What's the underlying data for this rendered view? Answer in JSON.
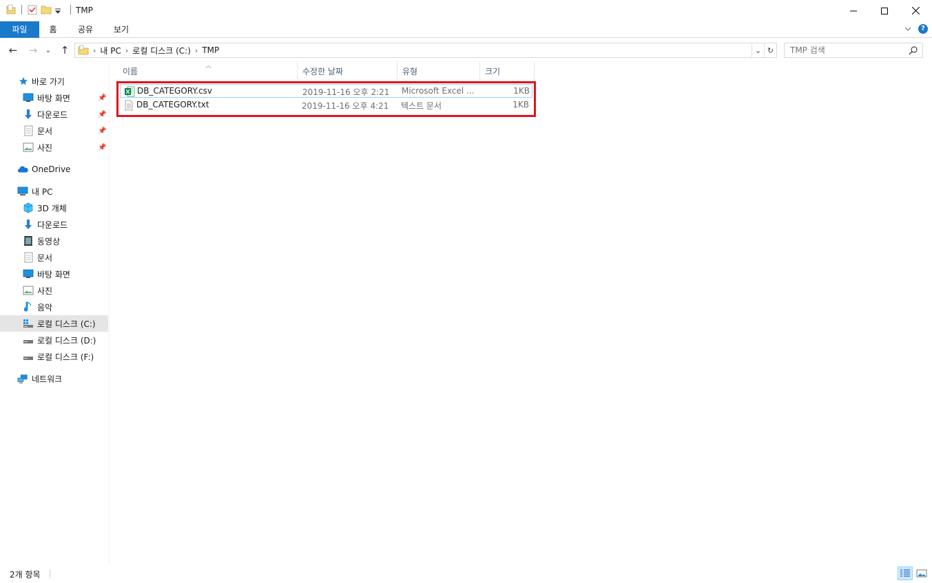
{
  "window": {
    "title": "TMP",
    "controls": {
      "minimize": "—",
      "maximize": "☐",
      "close": "✕"
    }
  },
  "ribbon": {
    "tabs": [
      "파일",
      "홈",
      "공유",
      "보기"
    ]
  },
  "navigation": {
    "back": "←",
    "forward": "→",
    "recent": "⌄",
    "up": "↑",
    "breadcrumb": [
      "내 PC",
      "로컬 디스크 (C:)",
      "TMP"
    ],
    "search_placeholder": "TMP 검색"
  },
  "sidebar": {
    "quick_access": {
      "label": "바로 가기",
      "items": [
        {
          "label": "바탕 화면",
          "icon": "desktop-icon",
          "pinned": true
        },
        {
          "label": "다운로드",
          "icon": "download-icon",
          "pinned": true
        },
        {
          "label": "문서",
          "icon": "document-icon",
          "pinned": true
        },
        {
          "label": "사진",
          "icon": "pictures-icon",
          "pinned": true
        }
      ]
    },
    "onedrive": {
      "label": "OneDrive"
    },
    "this_pc": {
      "label": "내 PC",
      "items": [
        {
          "label": "3D 개체",
          "icon": "3d-objects-icon"
        },
        {
          "label": "다운로드",
          "icon": "download-icon"
        },
        {
          "label": "동영상",
          "icon": "video-icon"
        },
        {
          "label": "문서",
          "icon": "document-icon"
        },
        {
          "label": "바탕 화면",
          "icon": "desktop-icon"
        },
        {
          "label": "사진",
          "icon": "pictures-icon"
        },
        {
          "label": "음악",
          "icon": "music-icon"
        },
        {
          "label": "로컬 디스크 (C:)",
          "icon": "windows-drive-icon",
          "selected": true
        },
        {
          "label": "로컬 디스크 (D:)",
          "icon": "drive-icon"
        },
        {
          "label": "로컬 디스크 (F:)",
          "icon": "drive-icon"
        }
      ]
    },
    "network": {
      "label": "네트워크"
    }
  },
  "columns": {
    "name": "이름",
    "modified": "수정한 날짜",
    "type": "유형",
    "size": "크기"
  },
  "files": [
    {
      "name": "DB_CATEGORY.csv",
      "modified": "2019-11-16 오후 2:21",
      "type": "Microsoft Excel ...",
      "size": "1KB",
      "icon": "excel-csv-icon"
    },
    {
      "name": "DB_CATEGORY.txt",
      "modified": "2019-11-16 오후 4:21",
      "type": "텍스트 문서",
      "size": "1KB",
      "icon": "text-file-icon"
    }
  ],
  "status": {
    "item_count": "2개 항목"
  },
  "colors": {
    "file_tab": "#1979ca",
    "highlight_border": "#e0131c",
    "selected_nav": "#e5e5e5"
  }
}
